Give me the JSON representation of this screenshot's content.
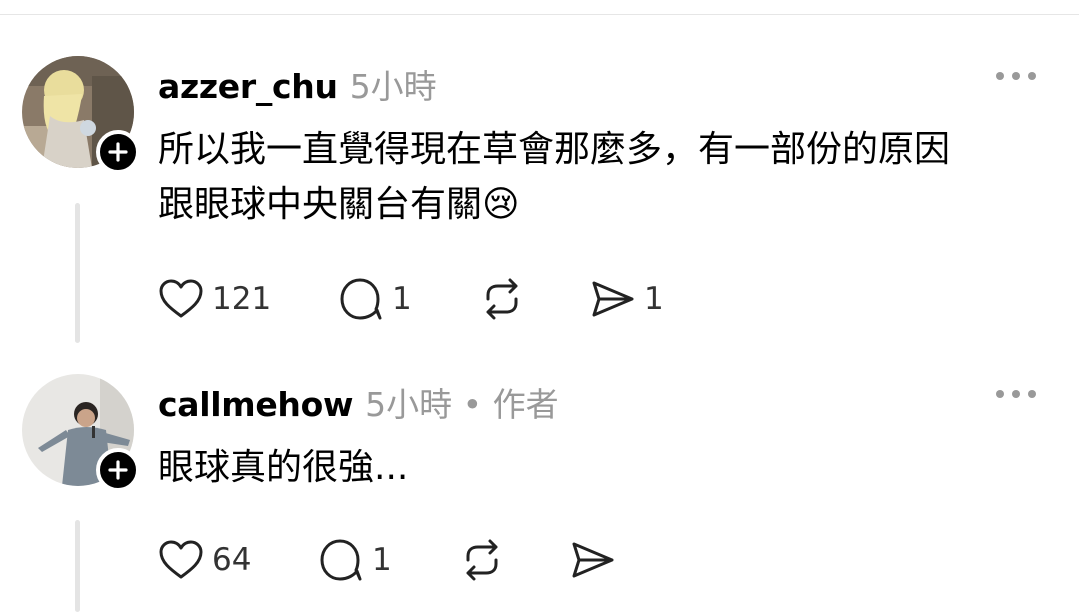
{
  "comments": [
    {
      "username": "azzer_chu",
      "meta": "5小時",
      "text_line1": "所以我一直覺得現在草會那麼多，有一部份的原因",
      "text_line2": "跟眼球中央關台有關😢",
      "likes": "121",
      "replies": "1",
      "reposts": "",
      "shares": "1"
    },
    {
      "username": "callmehow",
      "meta": "5小時 • 作者",
      "text_line1": "眼球真的很強...",
      "likes": "64",
      "replies": "1",
      "reposts": "",
      "shares": ""
    }
  ],
  "icons": {
    "follow": "plus-icon",
    "more": "more-options-icon",
    "like": "heart-icon",
    "reply": "comment-icon",
    "repost": "repost-icon",
    "share": "send-icon"
  },
  "colors": {
    "secondary_text": "#999999",
    "thread_line": "#e4e4e4"
  }
}
